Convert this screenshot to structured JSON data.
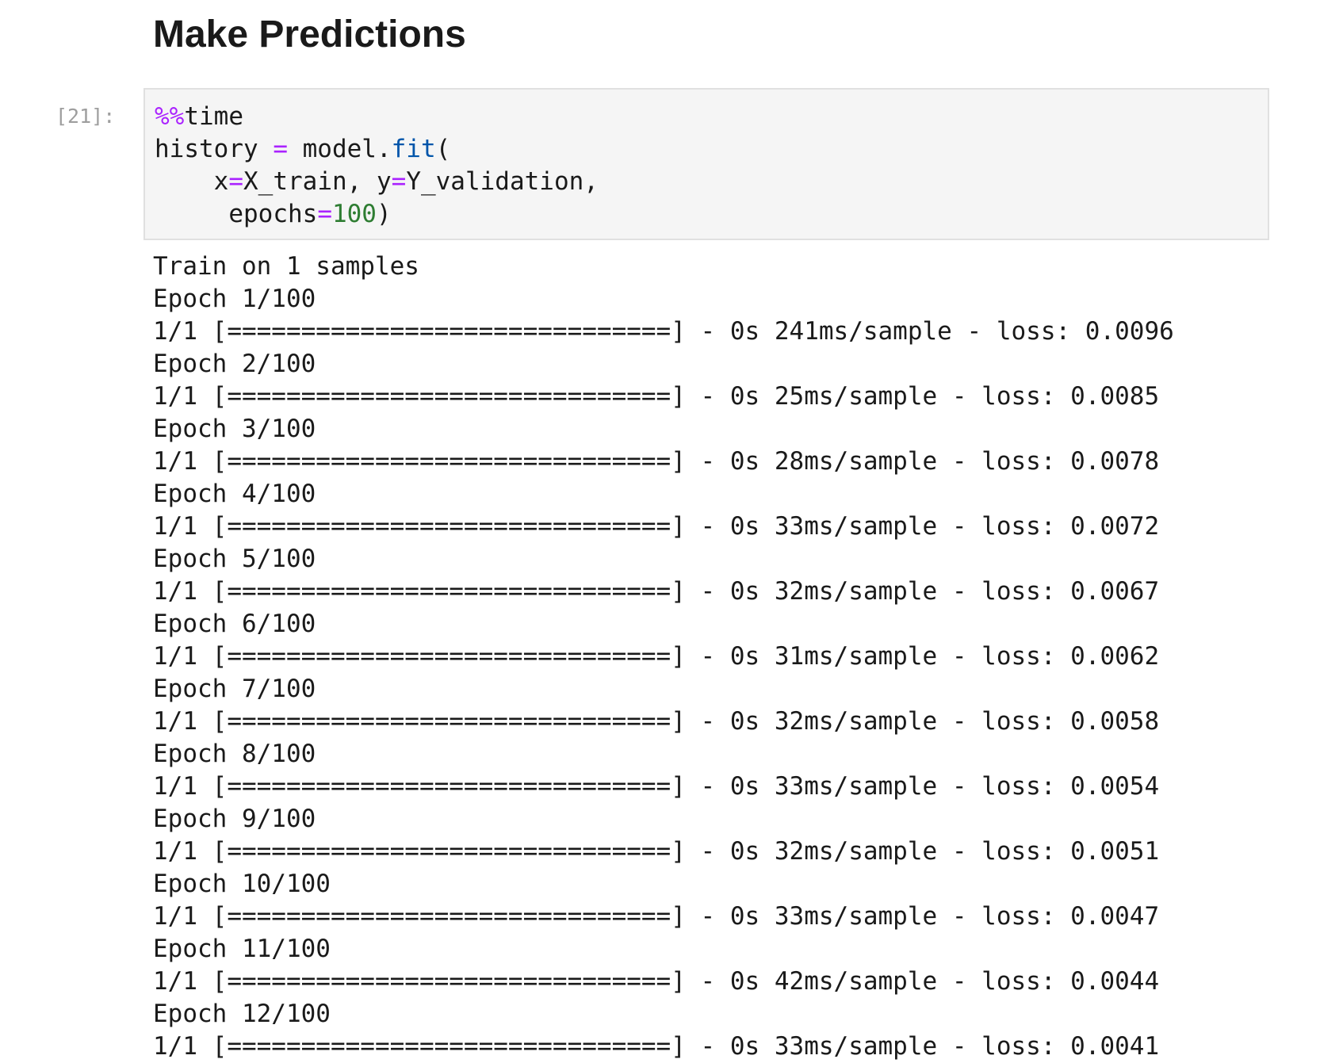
{
  "section": {
    "title": "Make Predictions"
  },
  "cell": {
    "prompt": "[21]:",
    "code": {
      "line1": {
        "magic": "%%",
        "rest": "time"
      },
      "line2": {
        "a": "history ",
        "op": "=",
        "b": " model.",
        "attr": "fit",
        "c": "("
      },
      "line3": {
        "indent": "    ",
        "a": "x",
        "op1": "=",
        "b": "X_train, y",
        "op2": "=",
        "c": "Y_validation,"
      },
      "line4": {
        "indent": "     ",
        "a": "epochs",
        "op": "=",
        "num": "100",
        "c": ")"
      }
    }
  },
  "output": {
    "lines": [
      "Train on 1 samples",
      "Epoch 1/100",
      "1/1 [==============================] - 0s 241ms/sample - loss: 0.0096",
      "Epoch 2/100",
      "1/1 [==============================] - 0s 25ms/sample - loss: 0.0085",
      "Epoch 3/100",
      "1/1 [==============================] - 0s 28ms/sample - loss: 0.0078",
      "Epoch 4/100",
      "1/1 [==============================] - 0s 33ms/sample - loss: 0.0072",
      "Epoch 5/100",
      "1/1 [==============================] - 0s 32ms/sample - loss: 0.0067",
      "Epoch 6/100",
      "1/1 [==============================] - 0s 31ms/sample - loss: 0.0062",
      "Epoch 7/100",
      "1/1 [==============================] - 0s 32ms/sample - loss: 0.0058",
      "Epoch 8/100",
      "1/1 [==============================] - 0s 33ms/sample - loss: 0.0054",
      "Epoch 9/100",
      "1/1 [==============================] - 0s 32ms/sample - loss: 0.0051",
      "Epoch 10/100",
      "1/1 [==============================] - 0s 33ms/sample - loss: 0.0047",
      "Epoch 11/100",
      "1/1 [==============================] - 0s 42ms/sample - loss: 0.0044",
      "Epoch 12/100",
      "1/1 [==============================] - 0s 33ms/sample - loss: 0.0041"
    ]
  }
}
